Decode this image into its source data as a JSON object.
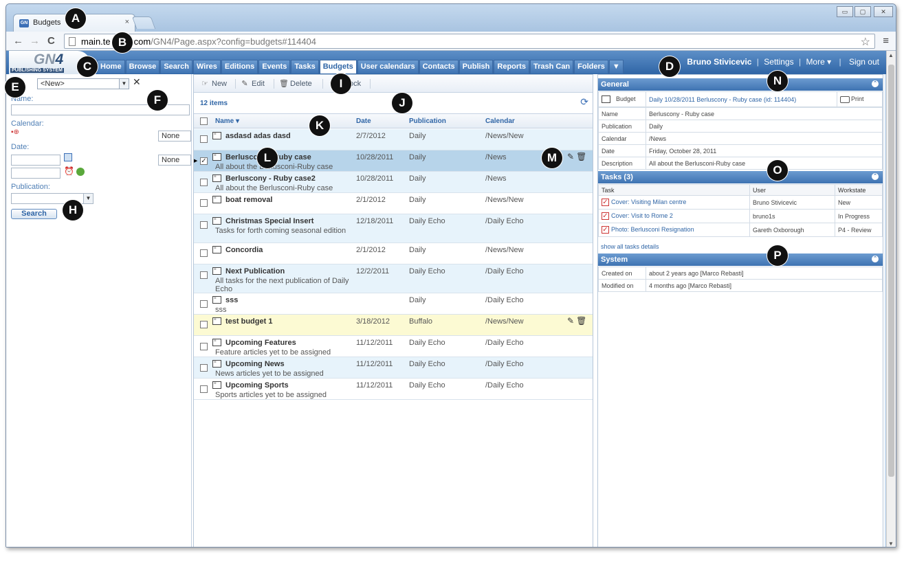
{
  "browser": {
    "tab_title": "Budgets",
    "tab_close": "×",
    "favicon_text": "GN",
    "url_host": "main.te",
    "url_rest_hidden": "com",
    "url_path": "/GN4/Page.aspx?config=budgets#114404",
    "back_icon": "←",
    "forward_icon": "→",
    "reload_icon": "C",
    "star_icon": "☆",
    "menu_icon": "≡",
    "window_controls": [
      "▭",
      "▢",
      "✕"
    ]
  },
  "app": {
    "logo_text_gn": "GN",
    "logo_text_4": "4",
    "logo_subtitle": "PUBLISHING SYSTEM",
    "nav_tabs": [
      "Home",
      "Browse",
      "Search",
      "Wires",
      "Editions",
      "Events",
      "Tasks",
      "Budgets",
      "User calendars",
      "Contacts",
      "Publish",
      "Reports",
      "Trash Can",
      "Folders",
      "▼"
    ],
    "active_tab": "Budgets",
    "user_name": "Bruno Stivicevic",
    "settings_link": "Settings",
    "more_link": "More ▾",
    "signout_link": "Sign out",
    "separator": "|"
  },
  "left_panel": {
    "preset_value": "<New>",
    "clear_icon": "✕",
    "name_label": "Name:",
    "calendar_label": "Calendar:",
    "calendar_none": "None",
    "date_label": "Date:",
    "date_none": "None",
    "publication_label": "Publication:",
    "search_button": "Search"
  },
  "middle_panel": {
    "toolbar": {
      "new_label": "New",
      "edit_label": "Edit",
      "delete_label": "Delete",
      "lock_label": "ock"
    },
    "item_count": "12 items",
    "refresh_icon": "⟳",
    "columns": {
      "name": "Name ▾",
      "date": "Date",
      "publication": "Publication",
      "calendar": "Calendar"
    },
    "rows": [
      {
        "name": "asdasd adas dasd",
        "desc": "",
        "date": "2/7/2012",
        "pub": "Daily",
        "cal": "/News/New"
      },
      {
        "name": "Berluscony - Ruby case",
        "desc": "All about the Berlusconi-Ruby case",
        "date": "10/28/2011",
        "pub": "Daily",
        "cal": "/News"
      },
      {
        "name": "Berluscony - Ruby case2",
        "desc": "All about the Berlusconi-Ruby case",
        "date": "10/28/2011",
        "pub": "Daily",
        "cal": "/News"
      },
      {
        "name": "boat removal",
        "desc": "",
        "date": "2/1/2012",
        "pub": "Daily",
        "cal": "/News/New"
      },
      {
        "name": "Christmas Special Insert",
        "desc": "Tasks for forth coming seasonal edition",
        "date": "12/18/2011",
        "pub": "Daily Echo",
        "cal": "/Daily Echo"
      },
      {
        "name": "Concordia",
        "desc": "",
        "date": "2/1/2012",
        "pub": "Daily",
        "cal": "/News/New"
      },
      {
        "name": "Next Publication",
        "desc": "All tasks for the next publication of Daily Echo",
        "date": "12/2/2011",
        "pub": "Daily Echo",
        "cal": "/Daily Echo"
      },
      {
        "name": "sss",
        "desc": "sss",
        "date": "",
        "pub": "Daily",
        "cal": "/Daily Echo"
      },
      {
        "name": "test budget 1",
        "desc": "",
        "date": "3/18/2012",
        "pub": "Buffalo",
        "cal": "/News/New"
      },
      {
        "name": "Upcoming Features",
        "desc": "Feature articles yet to be assigned",
        "date": "11/12/2011",
        "pub": "Daily Echo",
        "cal": "/Daily Echo"
      },
      {
        "name": "Upcoming News",
        "desc": "News articles yet to be assigned",
        "date": "11/12/2011",
        "pub": "Daily Echo",
        "cal": "/Daily Echo"
      },
      {
        "name": "Upcoming Sports",
        "desc": "Sports articles yet to be assigned",
        "date": "11/12/2011",
        "pub": "Daily Echo",
        "cal": "/Daily Echo"
      }
    ]
  },
  "right_panel": {
    "general": {
      "title": "General",
      "budget_label": "Budget",
      "budget_link": "Daily 10/28/2011 Berluscony - Ruby case (id: 114404)",
      "print_label": "Print",
      "fields": [
        {
          "k": "Name",
          "v": "Berluscony - Ruby case"
        },
        {
          "k": "Publication",
          "v": "Daily"
        },
        {
          "k": "Calendar",
          "v": "/News"
        },
        {
          "k": "Date",
          "v": "Friday, October 28, 2011"
        },
        {
          "k": "Description",
          "v": "All about the Berlusconi-Ruby case"
        }
      ]
    },
    "tasks": {
      "title": "Tasks (3)",
      "col_task": "Task",
      "col_user": "User",
      "col_workstate": "Workstate",
      "items": [
        {
          "task": "Cover: Visiting Milan centre",
          "user": "Bruno Stivicevic",
          "state": "New"
        },
        {
          "task": "Cover: Visit to Rome 2",
          "user": "bruno1s",
          "state": "In Progress"
        },
        {
          "task": "Photo: Berlusconi Resignation",
          "user": "Gareth Oxborough",
          "state": "P4 - Review"
        }
      ],
      "show_all": "show all tasks details"
    },
    "system": {
      "title": "System",
      "created_label": "Created on",
      "created_value": "about 2 years ago [Marco Rebasti]",
      "modified_label": "Modified on",
      "modified_value": "4 months ago [Marco Rebasti]"
    },
    "collapse_icon": "⌃"
  },
  "callouts": [
    "A",
    "B",
    "C",
    "D",
    "E",
    "F",
    "H",
    "I",
    "J",
    "K",
    "L",
    "M",
    "N",
    "O",
    "P"
  ]
}
